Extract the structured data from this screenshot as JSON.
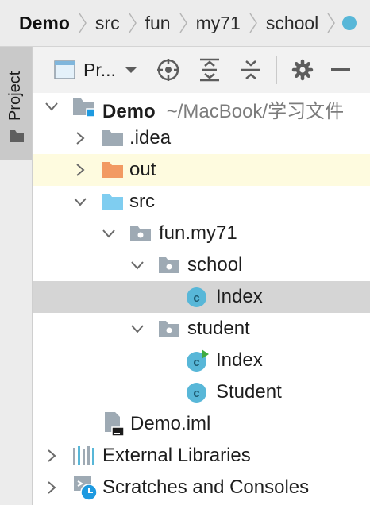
{
  "breadcrumb": {
    "items": [
      "Demo",
      "src",
      "fun",
      "my71",
      "school"
    ]
  },
  "sidebar": {
    "tab_label": "Project"
  },
  "toolbar": {
    "view_label": "Pr...",
    "icons": [
      "locate-icon",
      "expand-all-icon",
      "collapse-all-icon",
      "settings-icon",
      "hide-icon"
    ]
  },
  "tree": {
    "root": {
      "label": "Demo",
      "path": "~/MacBook/学习文件"
    },
    "idea": "idea",
    "out": "out",
    "src": "src",
    "package": "fun.my71",
    "school": "school",
    "school_index": "Index",
    "student": "student",
    "student_index": "Index",
    "student_class": "Student",
    "iml": "Demo.iml",
    "external": "External Libraries",
    "scratches": "Scratches and Consoles"
  },
  "colors": {
    "folder_gray": "#9eaab4",
    "folder_orange": "#f29a63",
    "folder_blue": "#7fcdf0",
    "class_icon": "#58b7d8",
    "selection": "#d5d5d5",
    "highlight": "#fefbdf"
  }
}
